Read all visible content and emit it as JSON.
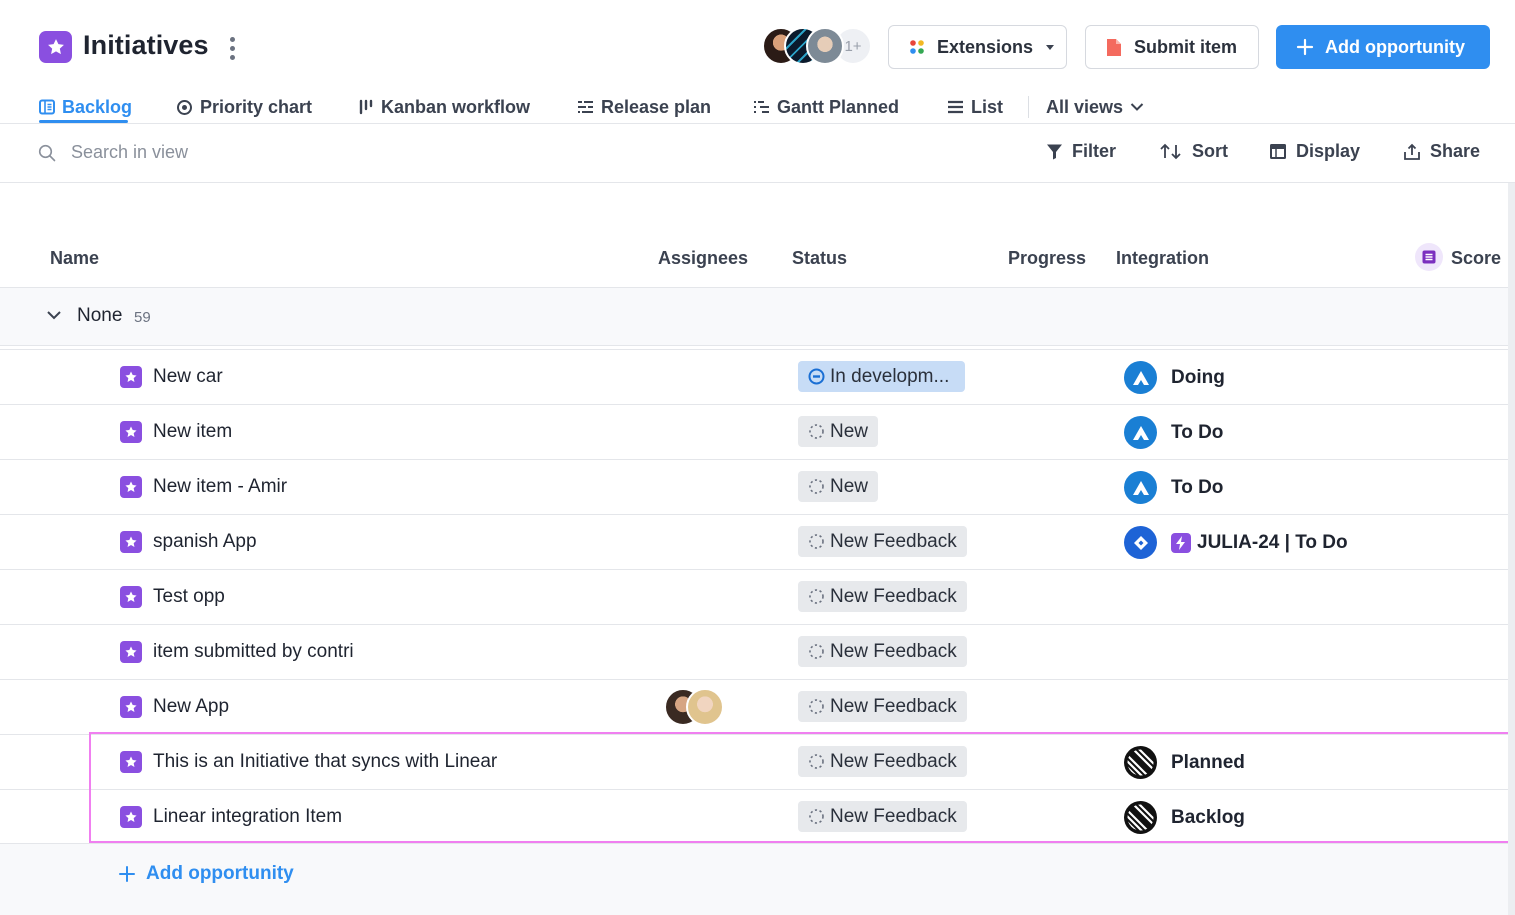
{
  "header": {
    "title": "Initiatives",
    "avatar_more": "1+",
    "extensions_label": "Extensions",
    "submit_label": "Submit item",
    "add_label": "Add opportunity",
    "accent_color": "#2f8ef0",
    "brand_color": "#8a4fe0"
  },
  "tabs": [
    {
      "label": "Backlog",
      "icon": "backlog-icon",
      "active": true
    },
    {
      "label": "Priority chart",
      "icon": "priority-chart-icon"
    },
    {
      "label": "Kanban workflow",
      "icon": "kanban-icon"
    },
    {
      "label": "Release plan",
      "icon": "release-plan-icon"
    },
    {
      "label": "Gantt Planned",
      "icon": "gantt-icon"
    },
    {
      "label": "List",
      "icon": "list-icon"
    },
    {
      "label": "All views",
      "icon": "chevron-down-icon"
    }
  ],
  "toolbar": {
    "search_placeholder": "Search in view",
    "filter": "Filter",
    "sort": "Sort",
    "display": "Display",
    "share": "Share"
  },
  "table": {
    "columns": {
      "name": "Name",
      "assignees": "Assignees",
      "status": "Status",
      "progress": "Progress",
      "integration": "Integration",
      "score": "Score"
    },
    "group": {
      "label": "None",
      "count": "59"
    },
    "rows": [
      {
        "name": "New car",
        "status": "In developm...",
        "status_kind": "in-development",
        "integration": "Doing",
        "integration_type": "azure-devops"
      },
      {
        "name": "New item",
        "status": "New",
        "status_kind": "new",
        "integration": "To Do",
        "integration_type": "azure-devops"
      },
      {
        "name": "New item - Amir",
        "status": "New",
        "status_kind": "new",
        "integration": "To Do",
        "integration_type": "azure-devops"
      },
      {
        "name": "spanish App",
        "status": "New Feedback",
        "status_kind": "new",
        "integration": "JULIA-24 | To Do",
        "integration_type": "jira"
      },
      {
        "name": "Test opp",
        "status": "New Feedback",
        "status_kind": "new",
        "integration": "",
        "integration_type": ""
      },
      {
        "name": "item submitted by contri",
        "status": "New Feedback",
        "status_kind": "new",
        "integration": "",
        "integration_type": ""
      },
      {
        "name": "New App",
        "status": "New Feedback",
        "status_kind": "new",
        "integration": "",
        "integration_type": "",
        "has_assignees": true
      },
      {
        "name": "This is an Initiative that syncs with Linear",
        "status": "New Feedback",
        "status_kind": "new",
        "integration": "Planned",
        "integration_type": "linear"
      },
      {
        "name": "Linear integration Item",
        "status": "New Feedback",
        "status_kind": "new",
        "integration": "Backlog",
        "integration_type": "linear"
      }
    ],
    "add_label": "Add opportunity"
  }
}
